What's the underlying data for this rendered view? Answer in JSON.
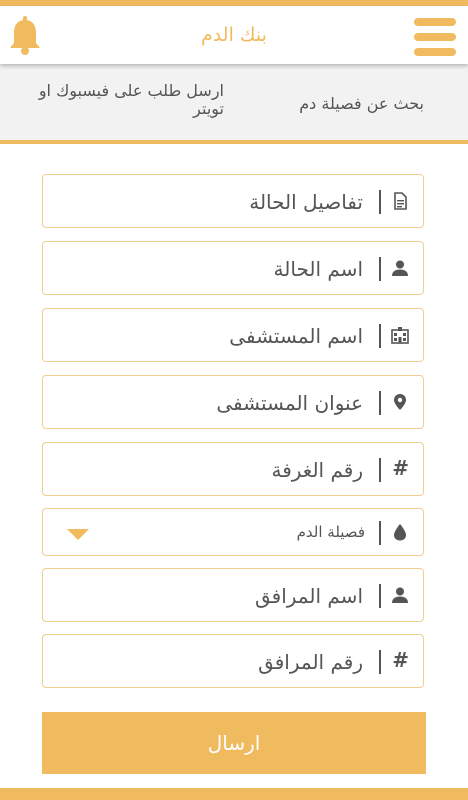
{
  "app": {
    "title": "بنك الدم"
  },
  "colors": {
    "accent": "#f0bb5f",
    "field_border": "#f1cf90",
    "icon": "#555555"
  },
  "icons": {
    "notifications": "bell-icon",
    "menu": "hamburger-menu-icon"
  },
  "tabs": [
    {
      "label": "بحث عن فصيلة دم",
      "active": false
    },
    {
      "label": "ارسل طلب على فيسبوك او تويتر",
      "active": true
    }
  ],
  "form": {
    "fields": [
      {
        "placeholder": "تفاصيل الحالة",
        "icon": "document-icon"
      },
      {
        "placeholder": "اسم الحالة",
        "icon": "person-icon"
      },
      {
        "placeholder": "اسم المستشفى",
        "icon": "hospital-icon"
      },
      {
        "placeholder": "عنوان المستشفى",
        "icon": "location-pin-icon"
      },
      {
        "placeholder": "رقم الغرفة",
        "icon": "hash-icon"
      },
      {
        "placeholder": "اسم المرافق",
        "icon": "person-icon"
      },
      {
        "placeholder": "رقم المرافق",
        "icon": "hash-icon"
      }
    ],
    "blood_type": {
      "selected": "فصيلة الدم",
      "icon": "blood-drop-icon"
    },
    "hash_symbol": "#",
    "submit_label": "ارسال"
  }
}
